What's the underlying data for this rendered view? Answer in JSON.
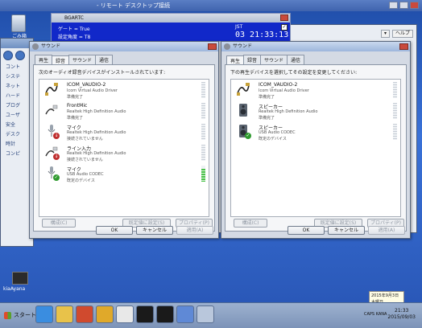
{
  "remote_bar": {
    "title": "- リモート デスクトップ接続"
  },
  "desktop": {
    "recycle_label": "ごみ箱",
    "kiaki_label": "kiaAyana"
  },
  "control_panel": {
    "items": [
      "コント",
      "システ",
      "ネット",
      "ハード",
      "プログ",
      "ユーザ",
      "安全",
      "デスク",
      "時計",
      "コンピ"
    ]
  },
  "right_bg_window": {
    "buttons": [
      "▾",
      "ヘルプ"
    ]
  },
  "bgartc": {
    "title": "BGARTC",
    "line1": "ゲート = True",
    "line2": "設定角度 =     T8",
    "tz": "JST",
    "time": "03 21:33:13",
    "check": "✓"
  },
  "left_dialog": {
    "title": "サウンド",
    "tabs": [
      "再生",
      "録音",
      "サウンド",
      "通信"
    ],
    "active_tab": 1,
    "instruction": "次のオーディオ録音デバイスがインストールされています:",
    "devices": [
      {
        "name": "ICOM_VAUDIO-2",
        "driver": "Icom Virtual Audio Driver",
        "status": "準備完了",
        "icon": "cable-icon",
        "state": "none",
        "level": 0
      },
      {
        "name": "FrontMic",
        "driver": "Realtek High Definition Audio",
        "status": "準備完了",
        "icon": "jack-icon",
        "state": "none",
        "level": 0
      },
      {
        "name": "マイク",
        "driver": "Realtek High Definition Audio",
        "status": "接続されていません",
        "icon": "mic-icon",
        "state": "down",
        "level": 0
      },
      {
        "name": "ライン入力",
        "driver": "Realtek High Definition Audio",
        "status": "接続されていません",
        "icon": "line-in-icon",
        "state": "down",
        "level": 0
      },
      {
        "name": "マイク",
        "driver": "USB Audio CODEC",
        "status": "既定のデバイス",
        "icon": "usb-mic-icon",
        "state": "ok",
        "level": 0.8
      }
    ],
    "buttons": {
      "configure": "構成(C)",
      "set_default": "既定値に設定(S)",
      "properties": "プロパティ(P)"
    },
    "footer": {
      "ok": "OK",
      "cancel": "キャンセル",
      "apply": "適用(A)"
    }
  },
  "right_dialog": {
    "title": "サウンド",
    "tabs": [
      "再生",
      "録音",
      "サウンド",
      "通信"
    ],
    "active_tab": 0,
    "instruction": "下の再生デバイスを選択してその設定を変更してください:",
    "devices": [
      {
        "name": "ICOM_VAUDIO-2",
        "driver": "Icom Virtual Audio Driver",
        "status": "準備完了",
        "icon": "cable-icon",
        "state": "none",
        "level": 0
      },
      {
        "name": "スピーカー",
        "driver": "Realtek High Definition Audio",
        "status": "準備完了",
        "icon": "speaker-icon",
        "state": "none",
        "level": 0
      },
      {
        "name": "スピーカー",
        "driver": "USB Audio CODEC",
        "status": "既定のデバイス",
        "icon": "usb-speaker-icon",
        "state": "ok",
        "level": 0
      }
    ],
    "buttons": {
      "configure": "構成(C)",
      "set_default": "既定値に設定(S)",
      "properties": "プロパティ(P)"
    },
    "footer": {
      "ok": "OK",
      "cancel": "キャンセル",
      "apply": "適用(A)"
    }
  },
  "taskbar": {
    "start_label": "スタート",
    "apps": [
      "ie-icon",
      "explorer-icon",
      "media-player-icon",
      "chrome-icon",
      "rt-icon",
      "icom-icon",
      "icom-remote-icon",
      "window-icon",
      "sound-icon"
    ],
    "tray_text": "CAPS KANA",
    "clock_time": "21:33",
    "clock_date": "2015/09/03",
    "tooltip_line1": "2015年9月3日",
    "tooltip_line2": "木曜日"
  }
}
